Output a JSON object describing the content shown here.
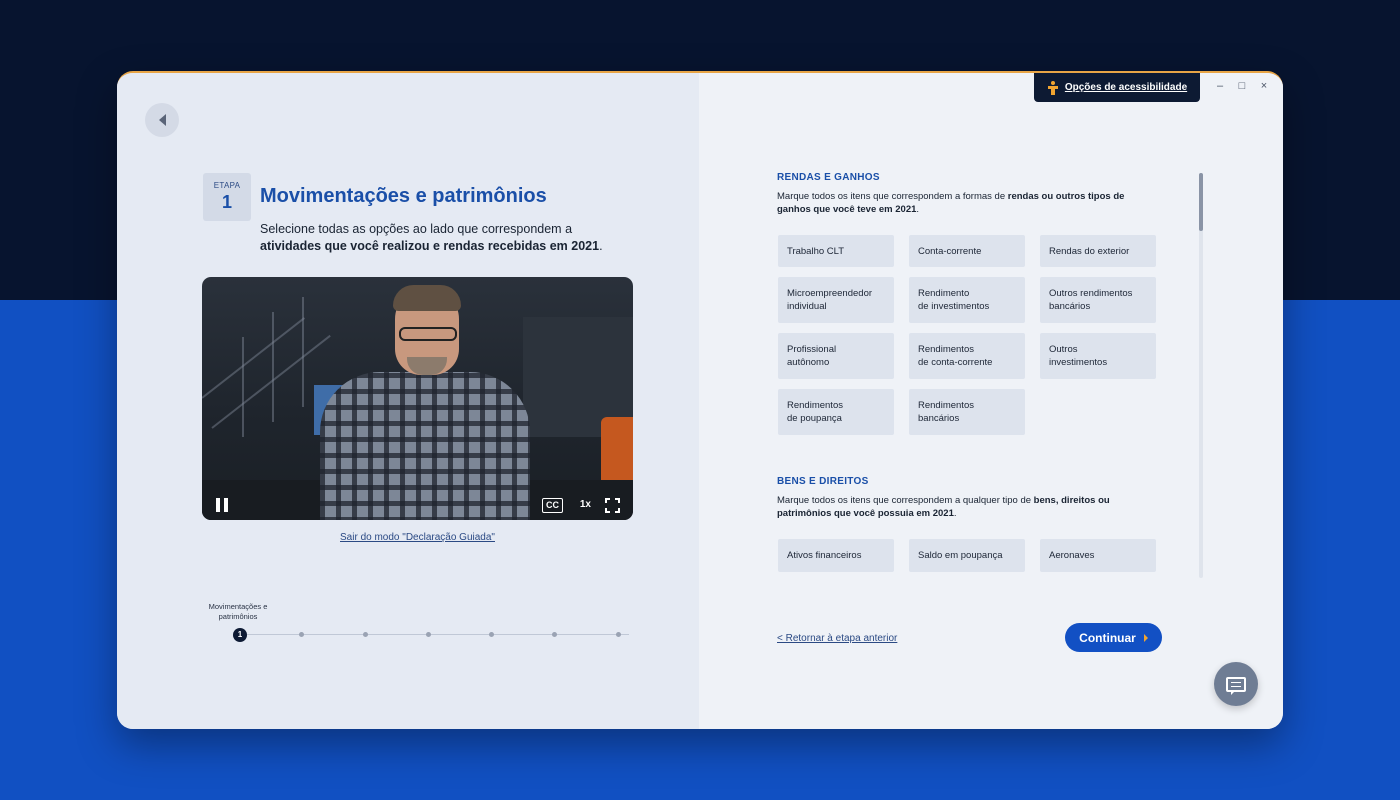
{
  "accessibility": {
    "label": "Opções de acessibilidade"
  },
  "window_controls": {
    "minimize": "–",
    "maximize": "□",
    "close": "×"
  },
  "step": {
    "label": "ETAPA",
    "number": "1"
  },
  "header": {
    "title": "Movimentações e patrimônios",
    "subtitle_intro": "Selecione todas as opções ao lado que correspondem a ",
    "subtitle_bold": "atividades que você realizou e rendas recebidas em 2021",
    "subtitle_end": "."
  },
  "video": {
    "cc": "CC",
    "speed": "1x"
  },
  "exit_link": "Sair do modo \"Declaração Guiada\"",
  "progress": {
    "current_label": "Movimentações e patrimônios",
    "current_step": "1",
    "total_steps": 7
  },
  "sections": [
    {
      "title": "RENDAS E GANHOS",
      "desc_intro": "Marque todos os itens que correspondem a formas de ",
      "desc_bold": "rendas ou outros tipos de ganhos que você teve em 2021",
      "desc_end": ".",
      "options": [
        [
          "Trabalho CLT"
        ],
        [
          "Conta-corrente"
        ],
        [
          "Rendas do exterior"
        ],
        [
          "Microempreendedor",
          "individual"
        ],
        [
          "Rendimento",
          "de investimentos"
        ],
        [
          "Outros rendimentos",
          "bancários"
        ],
        [
          "Profissional",
          "autônomo"
        ],
        [
          "Rendimentos",
          "de conta-corrente"
        ],
        [
          "Outros",
          "investimentos"
        ],
        [
          "Rendimentos",
          "de poupança"
        ],
        [
          "Rendimentos",
          "bancários"
        ]
      ]
    },
    {
      "title": "BENS E DIREITOS",
      "desc_intro": "Marque todos os itens que correspondem a qualquer tipo de ",
      "desc_bold": "bens, direitos ou patrimônios que você possuia em 2021",
      "desc_end": ".",
      "options": [
        [
          "Ativos financeiros"
        ],
        [
          "Saldo em poupança"
        ],
        [
          "Aeronaves"
        ]
      ]
    }
  ],
  "footer": {
    "back_link": "< Retornar à etapa anterior",
    "continue_label": "Continuar"
  }
}
